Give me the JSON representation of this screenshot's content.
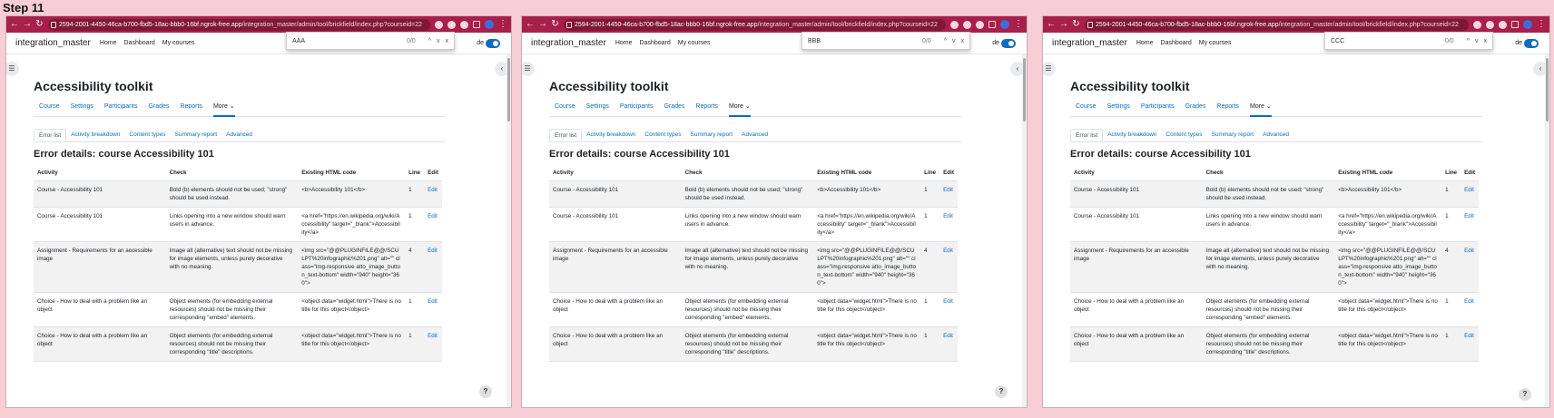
{
  "step_label": "Step 11",
  "url": {
    "host": "2594-2001-4450-46ca-b700-fbd5-18ac-bbb0-16bf.ngrok-free.app",
    "path": "/integration_master/admin/tool/brickfield/index.php?courseid=22"
  },
  "site": {
    "brand": "integration_master",
    "nav": [
      "Home",
      "Dashboard",
      "My courses"
    ],
    "edit_mode_fragment": "de"
  },
  "windows": [
    {
      "find_query": "AAA",
      "find_count": "0/0"
    },
    {
      "find_query": "BBB",
      "find_count": "0/0"
    },
    {
      "find_query": "CCC",
      "find_count": "0/0"
    }
  ],
  "find_buttons": {
    "up": "^",
    "down": "v",
    "close": "x"
  },
  "page": {
    "title": "Accessibility toolkit",
    "secondary_nav": [
      "Course",
      "Settings",
      "Participants",
      "Grades",
      "Reports",
      "More ⌄"
    ],
    "tabs": [
      "Error list",
      "Activity breakdown",
      "Content types",
      "Summary report",
      "Advanced"
    ],
    "subtitle": "Error details: course Accessibility 101",
    "columns": [
      "Activity",
      "Check",
      "Existing HTML code",
      "Line",
      "Edit"
    ],
    "rows": [
      {
        "activity": "Course - Accessibility 101",
        "check": "Bold (b) elements should not be used; \"strong\" should be used instead.",
        "code": "<b>Accessibility 101</b>",
        "line": "1",
        "edit": "Edit"
      },
      {
        "activity": "Course - Accessibility 101",
        "check": "Links opening into a new window should warn users in advance.",
        "code": "<a href=\"https://en.wikipedia.org/wiki/Accessibility\" target=\"_blank\">Accessibility</a>",
        "line": "1",
        "edit": "Edit"
      },
      {
        "activity": "Assignment - Requirements for an accessible image",
        "check": "Image alt (alternative) text should not be missing for image elements, unless purely decorative with no meaning.",
        "code": "<img src=\"@@PLUGINFILE@@/SCULPT%20infographic%201.png\" alt=\"\" class=\"img-responsive atto_image_button_text-bottom\" width=\"940\" height=\"360\">",
        "line": "4",
        "edit": "Edit"
      },
      {
        "activity": "Choice - How to deal with a problem like an object",
        "check": "Object elements (for embedding external resources) should not be missing their corresponding \"embed\" elements.",
        "code": "<object data=\"widget.html\">There is no title for this object</object>",
        "line": "1",
        "edit": "Edit"
      },
      {
        "activity": "Choice - How to deal with a problem like an object",
        "check": "Object elements (for embedding external resources) should not be missing their corresponding \"title\" descriptions.",
        "code": "<object data=\"widget.html\">There is no title for this object</object>",
        "line": "1",
        "edit": "Edit"
      }
    ],
    "help_label": "?"
  }
}
